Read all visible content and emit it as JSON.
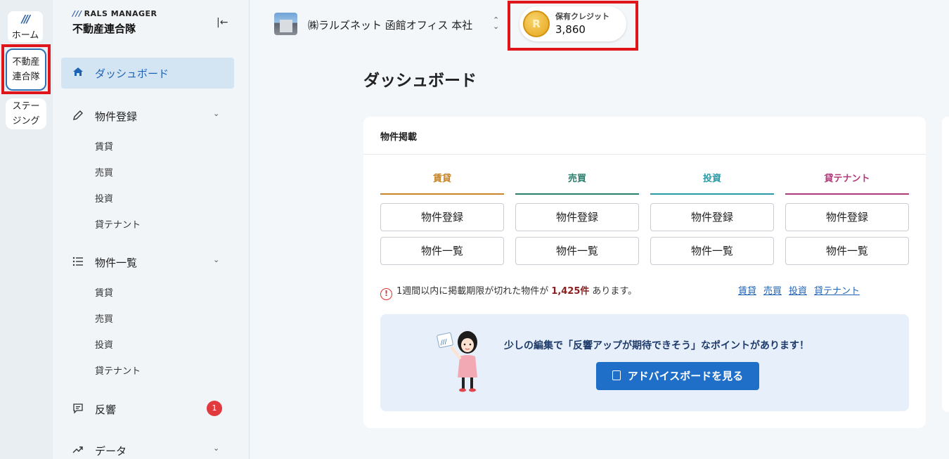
{
  "rail": {
    "home_label": "ホーム",
    "logo_mark": "///",
    "active_item_line1": "不動産",
    "active_item_line2": "連合隊",
    "staging_line1": "ステー",
    "staging_line2": "ジング"
  },
  "sidebar": {
    "brand_mark": "///",
    "brand_sub": "RALS MANAGER",
    "brand_main": "不動産連合隊",
    "dashboard_label": "ダッシュボード",
    "groups": [
      {
        "label": "物件登録",
        "items": [
          "賃貸",
          "売買",
          "投資",
          "貸テナント"
        ]
      },
      {
        "label": "物件一覧",
        "items": [
          "賃貸",
          "売買",
          "投資",
          "貸テナント"
        ]
      },
      {
        "label": "反響",
        "badge": "1"
      },
      {
        "label": "データ"
      }
    ]
  },
  "topbar": {
    "company_name": "㈱ラルズネット 函館オフィス 本社",
    "credit_label": "保有クレジット",
    "credit_value": "3,860",
    "coin_letter": "R"
  },
  "page": {
    "title": "ダッシュボード"
  },
  "listing_card": {
    "title": "物件掲載",
    "columns": [
      {
        "label": "賃貸",
        "color": "#c8862a",
        "register": "物件登録",
        "list": "物件一覧"
      },
      {
        "label": "売買",
        "color": "#2a7f6e",
        "register": "物件登録",
        "list": "物件一覧"
      },
      {
        "label": "投資",
        "color": "#2b9aa8",
        "register": "物件登録",
        "list": "物件一覧"
      },
      {
        "label": "貸テナント",
        "color": "#b23a7a",
        "register": "物件登録",
        "list": "物件一覧"
      }
    ],
    "warning_prefix": "1週間以内に掲載期限が切れた物件が",
    "warning_count": "1,425件",
    "warning_suffix": "あります。",
    "links": [
      "賃貸",
      "売買",
      "投資",
      "貸テナント"
    ],
    "advice_text": "少しの編集で「反響アップが期待できそう」なポイントがあります！",
    "advice_button": "アドバイスボードを見る"
  },
  "colors": {
    "accent": "#1f6fc9",
    "highlight_box": "#e0151b",
    "badge": "#e0393e"
  }
}
